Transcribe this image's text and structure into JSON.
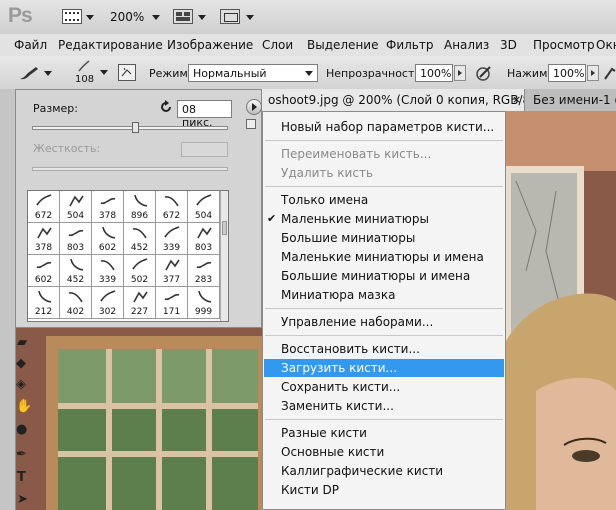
{
  "app": {
    "logo": "Ps",
    "zoom": "200%"
  },
  "menubar": [
    "Файл",
    "Редактирование",
    "Изображение",
    "Слои",
    "Выделение",
    "Фильтр",
    "Анализ",
    "3D",
    "Просмотр",
    "Окно"
  ],
  "options": {
    "brush_size_value": "108",
    "mode_label": "Режим:",
    "mode_value": "Нормальный",
    "opacity_label": "Непрозрачность:",
    "opacity_value": "100%",
    "flow_label": "Нажим:",
    "flow_value": "100%"
  },
  "tabs": [
    {
      "label": "oshoot9.jpg @ 200% (Слой 0 копия, RGB/8) *",
      "close": "×",
      "active": true
    },
    {
      "label": "Без имени-1 @",
      "active": false
    }
  ],
  "picker": {
    "size_label": "Размер:",
    "size_value": "08 пикс.",
    "hardness_label": "Жесткость:",
    "size_slider_fraction": 0.52,
    "brushes": [
      [
        "672",
        "504",
        "378",
        "896",
        "672",
        "504"
      ],
      [
        "378",
        "803",
        "602",
        "452",
        "339",
        "803"
      ],
      [
        "602",
        "452",
        "339",
        "502",
        "377",
        "283"
      ],
      [
        "212",
        "402",
        "302",
        "227",
        "171",
        "999"
      ]
    ]
  },
  "flyout": {
    "items": [
      {
        "label": "Новый набор параметров кисти...",
        "state": "normal"
      },
      {
        "sep": true
      },
      {
        "label": "Переименовать кисть...",
        "state": "disabled"
      },
      {
        "label": "Удалить кисть",
        "state": "disabled"
      },
      {
        "sep": true
      },
      {
        "label": "Только имена",
        "state": "normal"
      },
      {
        "label": "Маленькие миниатюры",
        "state": "checked"
      },
      {
        "label": "Большие миниатюры",
        "state": "normal"
      },
      {
        "label": "Маленькие миниатюры и имена",
        "state": "normal"
      },
      {
        "label": "Большие миниатюры и имена",
        "state": "normal"
      },
      {
        "label": "Миниатюра мазка",
        "state": "normal"
      },
      {
        "sep": true
      },
      {
        "label": "Управление наборами...",
        "state": "normal"
      },
      {
        "sep": true
      },
      {
        "label": "Восстановить кисти...",
        "state": "normal"
      },
      {
        "label": "Загрузить кисти...",
        "state": "highlighted"
      },
      {
        "label": "Сохранить кисти...",
        "state": "normal"
      },
      {
        "label": "Заменить кисти...",
        "state": "normal"
      },
      {
        "sep": true
      },
      {
        "label": "Разные кисти",
        "state": "normal"
      },
      {
        "label": "Основные кисти",
        "state": "normal"
      },
      {
        "label": "Каллиграфические кисти",
        "state": "normal"
      },
      {
        "label": "Кисти DP",
        "state": "normal"
      }
    ],
    "check_mark": "✔"
  }
}
